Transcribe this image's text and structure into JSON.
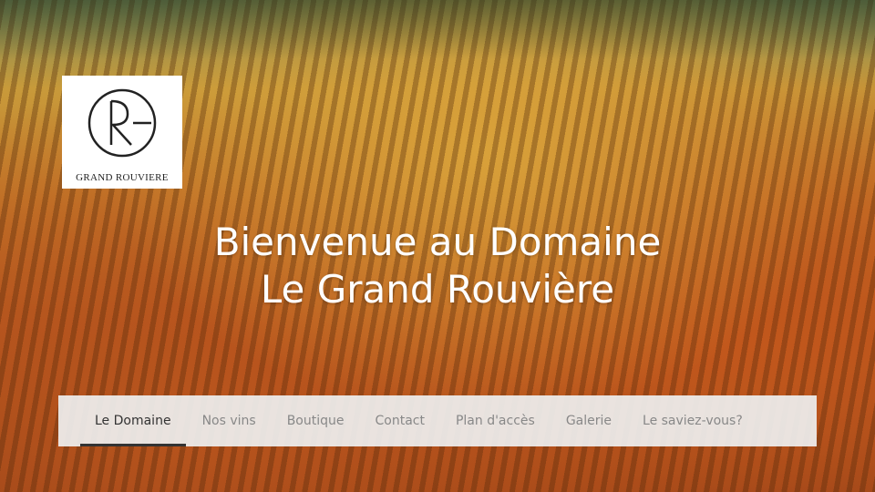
{
  "logo": {
    "monogram": "RG",
    "name": "GRAND ROUVIERE"
  },
  "hero": {
    "title_line1": "Bienvenue au Domaine",
    "title_line2": "Le Grand Rouvière"
  },
  "nav": {
    "items": [
      {
        "label": "Le Domaine",
        "active": true
      },
      {
        "label": "Nos vins",
        "active": false
      },
      {
        "label": "Boutique",
        "active": false
      },
      {
        "label": "Contact",
        "active": false
      },
      {
        "label": "Plan d'accès",
        "active": false
      },
      {
        "label": "Galerie",
        "active": false
      },
      {
        "label": "Le saviez-vous?",
        "active": false
      }
    ]
  },
  "colors": {
    "nav_bg": "#eeeeee",
    "nav_active": "#333333",
    "nav_inactive": "#888888",
    "title": "#ffffff"
  }
}
